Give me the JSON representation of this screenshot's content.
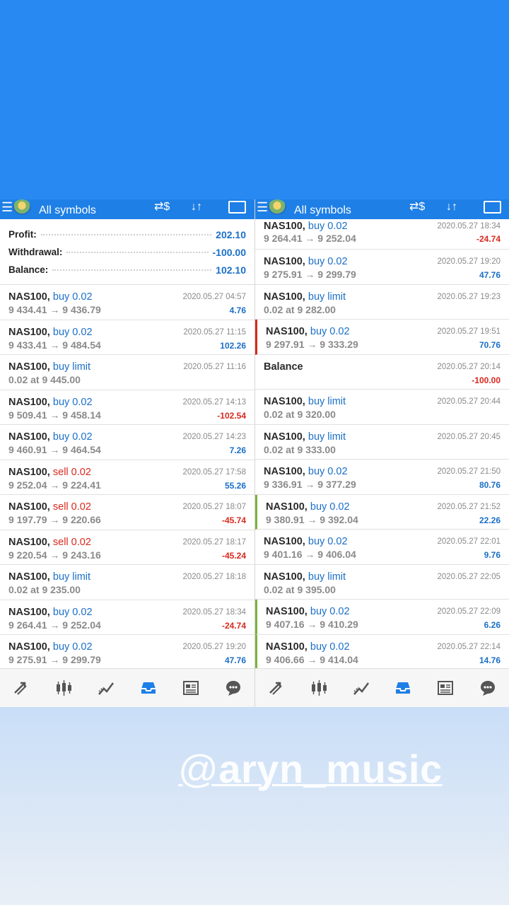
{
  "header": {
    "title": "All symbols"
  },
  "summary": {
    "profit_label": "Profit:",
    "profit_value": "202.10",
    "withdrawal_label": "Withdrawal:",
    "withdrawal_value": "-100.00",
    "balance_label": "Balance:",
    "balance_value": "102.10"
  },
  "left_trades": [
    {
      "symbol": "NAS100,",
      "type": "buy 0.02",
      "side": "buy",
      "detail": "9 434.41 → 9 436.79",
      "time": "2020.05.27 04:57",
      "profit": "4.76",
      "sign": "pos"
    },
    {
      "symbol": "NAS100,",
      "type": "buy 0.02",
      "side": "buy",
      "detail": "9 433.41 → 9 484.54",
      "time": "2020.05.27 11:15",
      "profit": "102.26",
      "sign": "pos"
    },
    {
      "symbol": "NAS100,",
      "type": "buy limit",
      "side": "buy",
      "detail": "0.02 at 9 445.00",
      "time": "2020.05.27 11:16",
      "profit": "",
      "sign": "pos"
    },
    {
      "symbol": "NAS100,",
      "type": "buy 0.02",
      "side": "buy",
      "detail": "9 509.41 → 9 458.14",
      "time": "2020.05.27 14:13",
      "profit": "-102.54",
      "sign": "neg"
    },
    {
      "symbol": "NAS100,",
      "type": "buy 0.02",
      "side": "buy",
      "detail": "9 460.91 → 9 464.54",
      "time": "2020.05.27 14:23",
      "profit": "7.26",
      "sign": "pos"
    },
    {
      "symbol": "NAS100,",
      "type": "sell 0.02",
      "side": "sell",
      "detail": "9 252.04 → 9 224.41",
      "time": "2020.05.27 17:58",
      "profit": "55.26",
      "sign": "pos"
    },
    {
      "symbol": "NAS100,",
      "type": "sell 0.02",
      "side": "sell",
      "detail": "9 197.79 → 9 220.66",
      "time": "2020.05.27 18:07",
      "profit": "-45.74",
      "sign": "neg"
    },
    {
      "symbol": "NAS100,",
      "type": "sell 0.02",
      "side": "sell",
      "detail": "9 220.54 → 9 243.16",
      "time": "2020.05.27 18:17",
      "profit": "-45.24",
      "sign": "neg"
    },
    {
      "symbol": "NAS100,",
      "type": "buy limit",
      "side": "buy",
      "detail": "0.02 at 9 235.00",
      "time": "2020.05.27 18:18",
      "profit": "",
      "sign": "pos"
    },
    {
      "symbol": "NAS100,",
      "type": "buy 0.02",
      "side": "buy",
      "detail": "9 264.41 → 9 252.04",
      "time": "2020.05.27 18:34",
      "profit": "-24.74",
      "sign": "neg"
    },
    {
      "symbol": "NAS100,",
      "type": "buy 0.02",
      "side": "buy",
      "detail": "9 275.91 → 9 299.79",
      "time": "2020.05.27 19:20",
      "profit": "47.76",
      "sign": "pos"
    }
  ],
  "right_trades": [
    {
      "symbol": "NAS100,",
      "type": "buy 0.02",
      "side": "buy",
      "detail": "9 264.41 → 9 252.04",
      "time": "2020.05.27 18:34",
      "profit": "-24.74",
      "sign": "neg",
      "mark": ""
    },
    {
      "symbol": "NAS100,",
      "type": "buy 0.02",
      "side": "buy",
      "detail": "9 275.91 → 9 299.79",
      "time": "2020.05.27 19:20",
      "profit": "47.76",
      "sign": "pos",
      "mark": ""
    },
    {
      "symbol": "NAS100,",
      "type": "buy limit",
      "side": "buy",
      "detail": "0.02 at 9 282.00",
      "time": "2020.05.27 19:23",
      "profit": "",
      "sign": "pos",
      "mark": ""
    },
    {
      "symbol": "NAS100,",
      "type": "buy 0.02",
      "side": "buy",
      "detail": "9 297.91 → 9 333.29",
      "time": "2020.05.27 19:51",
      "profit": "70.76",
      "sign": "pos",
      "mark": "red"
    },
    {
      "symbol": "Balance",
      "type": "",
      "side": "buy",
      "detail": "",
      "time": "2020.05.27 20:14",
      "profit": "-100.00",
      "sign": "neg",
      "mark": ""
    },
    {
      "symbol": "NAS100,",
      "type": "buy limit",
      "side": "buy",
      "detail": "0.02 at 9 320.00",
      "time": "2020.05.27 20:44",
      "profit": "",
      "sign": "pos",
      "mark": ""
    },
    {
      "symbol": "NAS100,",
      "type": "buy limit",
      "side": "buy",
      "detail": "0.02 at 9 333.00",
      "time": "2020.05.27 20:45",
      "profit": "",
      "sign": "pos",
      "mark": ""
    },
    {
      "symbol": "NAS100,",
      "type": "buy 0.02",
      "side": "buy",
      "detail": "9 336.91 → 9 377.29",
      "time": "2020.05.27 21:50",
      "profit": "80.76",
      "sign": "pos",
      "mark": ""
    },
    {
      "symbol": "NAS100,",
      "type": "buy 0.02",
      "side": "buy",
      "detail": "9 380.91 → 9 392.04",
      "time": "2020.05.27 21:52",
      "profit": "22.26",
      "sign": "pos",
      "mark": "green"
    },
    {
      "symbol": "NAS100,",
      "type": "buy 0.02",
      "side": "buy",
      "detail": "9 401.16 → 9 406.04",
      "time": "2020.05.27 22:01",
      "profit": "9.76",
      "sign": "pos",
      "mark": ""
    },
    {
      "symbol": "NAS100,",
      "type": "buy limit",
      "side": "buy",
      "detail": "0.02 at 9 395.00",
      "time": "2020.05.27 22:05",
      "profit": "",
      "sign": "pos",
      "mark": ""
    },
    {
      "symbol": "NAS100,",
      "type": "buy 0.02",
      "side": "buy",
      "detail": "9 407.16 → 9 410.29",
      "time": "2020.05.27 22:09",
      "profit": "6.26",
      "sign": "pos",
      "mark": "green"
    },
    {
      "symbol": "NAS100,",
      "type": "buy 0.02",
      "side": "buy",
      "detail": "9 406.66 → 9 414.04",
      "time": "2020.05.27 22:14",
      "profit": "14.76",
      "sign": "pos",
      "mark": "green"
    }
  ],
  "nav_icons": [
    "trade-arrows-icon",
    "candlestick-icon",
    "chart-trend-icon",
    "inbox-icon",
    "news-icon",
    "chat-icon"
  ],
  "watermark": {
    "at": "@",
    "handle": "aryn_music"
  },
  "colors": {
    "accent": "#1e7fe6",
    "buy": "#1a6fc7",
    "sell": "#d9281e",
    "mark_green": "#79b43d"
  }
}
